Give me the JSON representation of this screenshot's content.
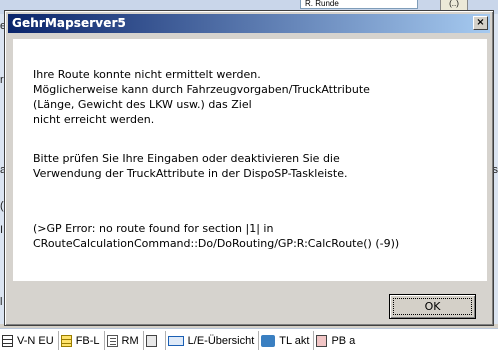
{
  "background": {
    "top_field_text": "R. Runde",
    "top_button_label": "(..)",
    "left_chars": [
      "e",
      "r",
      "a",
      "(I",
      "I",
      "l"
    ],
    "right_chars": [
      "eis"
    ]
  },
  "dialog": {
    "title": "GehrMapserver5",
    "close_label": "×",
    "message_lines_1": [
      "Ihre Route konnte nicht ermittelt werden.",
      "Möglicherweise kann durch Fahrzeugvorgaben/TruckAttribute",
      "(Länge, Gewicht des LKW usw.) das Ziel",
      "nicht erreicht werden."
    ],
    "message_lines_2": [
      "Bitte prüfen Sie Ihre Eingaben oder deaktivieren Sie die",
      "Verwendung der TruckAttribute in der DispoSP-Taskleiste."
    ],
    "message_lines_3": [
      "(>GP Error: no route found for section  |1| in",
      "CRouteCalculationCommand::Do/DoRouting/GP:R:CalcRoute() (-9))"
    ],
    "ok_label": "OK"
  },
  "taskbar": {
    "items": [
      {
        "label": "V-N EU",
        "icon": "grid-icon"
      },
      {
        "label": "FB-L",
        "icon": "yellow-list-icon"
      },
      {
        "label": "RM",
        "icon": "list-icon"
      },
      {
        "label": "",
        "icon": "document-icon"
      },
      {
        "label": "L/E-Übersicht",
        "icon": "flow-icon"
      },
      {
        "label": "TL akt",
        "icon": "truck-icon"
      },
      {
        "label": "PB a",
        "icon": "pb-icon"
      }
    ]
  }
}
